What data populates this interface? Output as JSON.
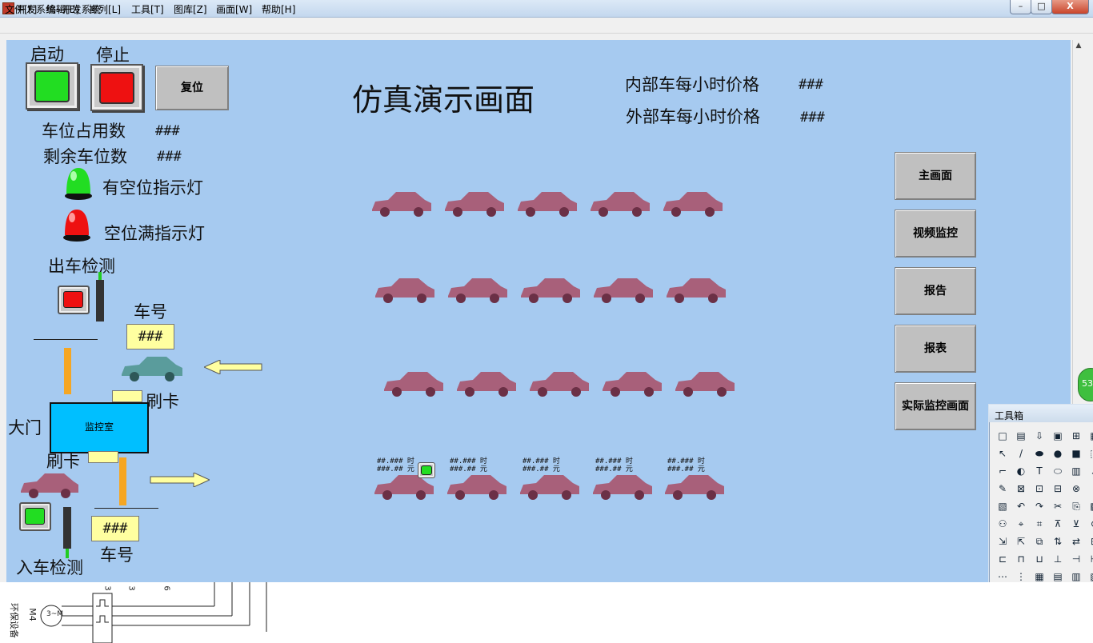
{
  "window": {
    "title": "开发系统--开发系统",
    "min_glyph": "–",
    "max_glyph": "□",
    "close_glyph": "X"
  },
  "menu": [
    "文件[F]",
    "编辑[E]",
    "排列[L]",
    "工具[T]",
    "图库[Z]",
    "画面[W]",
    "帮助[H]"
  ],
  "controls": {
    "start_label": "启动",
    "stop_label": "停止",
    "reset_label": "复位"
  },
  "stats": {
    "occupied_label": "车位占用数",
    "occupied_value": "###",
    "remaining_label": "剩余车位数",
    "remaining_value": "###"
  },
  "lamps": {
    "available_label": "有空位指示灯",
    "full_label": "空位满指示灯"
  },
  "title": "仿真演示画面",
  "prices": {
    "internal_label": "内部车每小时价格",
    "internal_value": "###",
    "external_label": "外部车每小时价格",
    "external_value": "###"
  },
  "gate": {
    "exit_detect_label": "出车检测",
    "entry_detect_label": "入车检测",
    "plate_label_top": "车号",
    "plate_value_top": "###",
    "plate_label_bottom": "车号",
    "plate_value_bottom": "###",
    "card_label_top": "刷卡",
    "card_label_bottom": "刷卡",
    "gate_label": "大门",
    "control_room_label": "监控室"
  },
  "slot_info_line1": "##.### 时",
  "slot_info_line2": "###.## 元",
  "nav": [
    "主画面",
    "视频监控",
    "报告",
    "报表",
    "实际监控画面"
  ],
  "toolbox": {
    "title": "工具箱"
  },
  "side_badge": "53",
  "colors": {
    "canvas": "#a6caf0",
    "car": "#a8607a",
    "teal_car": "#5a9c9c",
    "control_room": "#00bfff",
    "plate_box": "#ffffa0",
    "gate_bar": "#f5a623",
    "start_green": "#22dd22",
    "stop_red": "#ee1111"
  },
  "bottom_strip": {
    "left_label": "环保设备",
    "motor_label": "M4",
    "motor_symbol": "3~M",
    "numbers": [
      "3",
      "3",
      "6"
    ]
  }
}
